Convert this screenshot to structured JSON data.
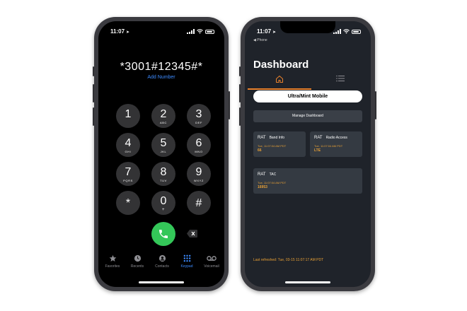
{
  "dialer": {
    "status": {
      "time": "11:07"
    },
    "number": "*3001#12345#*",
    "add_number": "Add Number",
    "keys": [
      {
        "digit": "1",
        "letters": ""
      },
      {
        "digit": "2",
        "letters": "ABC"
      },
      {
        "digit": "3",
        "letters": "DEF"
      },
      {
        "digit": "4",
        "letters": "GHI"
      },
      {
        "digit": "5",
        "letters": "JKL"
      },
      {
        "digit": "6",
        "letters": "MNO"
      },
      {
        "digit": "7",
        "letters": "PQRS"
      },
      {
        "digit": "8",
        "letters": "TUV"
      },
      {
        "digit": "9",
        "letters": "WXYZ"
      },
      {
        "digit": "*",
        "letters": ""
      },
      {
        "digit": "0",
        "letters": "+"
      },
      {
        "digit": "#",
        "letters": ""
      }
    ],
    "tabs": [
      "Favorites",
      "Recents",
      "Contacts",
      "Keypad",
      "Voicemail"
    ],
    "active_tab": "Keypad"
  },
  "dashboard": {
    "status": {
      "time": "11:07",
      "back_label": "◀ Phone"
    },
    "title": "Dashboard",
    "carrier_button": "Ultra/Mint Mobile",
    "manage_button": "Manage Dashboard",
    "cards": [
      {
        "label": "RAT",
        "name": "Band Info",
        "timestamp": "Tue, 11:07:04 AM PDT",
        "value": "66"
      },
      {
        "label": "RAT",
        "name": "Radio Access",
        "timestamp": "Tue, 11:07:04 AM PDT",
        "value": "LTE"
      },
      {
        "label": "RAT",
        "name": "TAC",
        "timestamp": "Tue, 11:07:04 AM PDT",
        "value": "16953"
      }
    ],
    "last_refreshed": "Last refreshed: Tue, 03-15 11:07:17 AM PDT"
  },
  "colors": {
    "accent_orange": "#e8812c",
    "ios_blue": "#3d8bff",
    "call_green": "#34c759"
  }
}
